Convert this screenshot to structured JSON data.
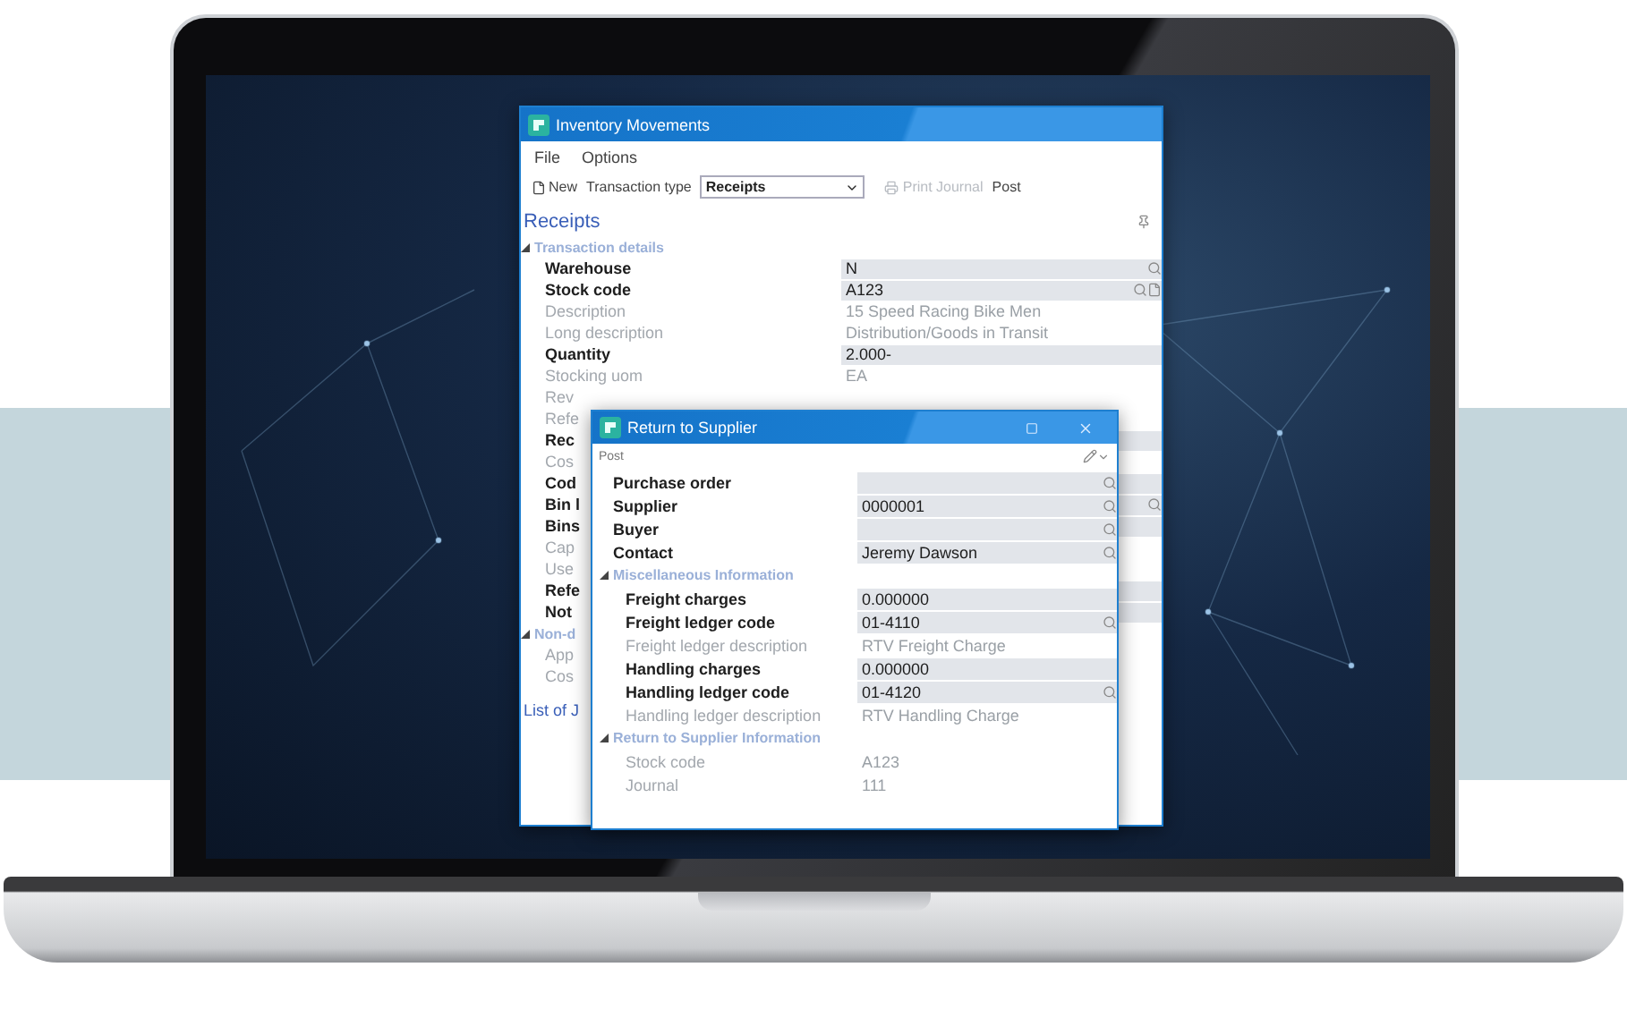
{
  "main_window": {
    "title": "Inventory Movements",
    "menu": [
      "File",
      "Options"
    ],
    "toolbar": {
      "new_button": "New",
      "type_label": "Transaction type",
      "type_value": "Receipts",
      "print_journal": {
        "label": "Print Journal",
        "disabled": true
      },
      "post": "Post"
    },
    "heading": "Receipts",
    "sections": [
      {
        "title": "Transaction details",
        "expanded": true,
        "rows": [
          {
            "label": "Warehouse",
            "value": "N",
            "kind": "lookup",
            "disabled": false
          },
          {
            "label": "Stock code",
            "value": "A123",
            "kind": "lookup_attach",
            "disabled": false
          },
          {
            "label": "Description",
            "value": "15 Speed Racing Bike Men",
            "kind": "field",
            "disabled": true
          },
          {
            "label": "Long description",
            "value": "Distribution/Goods in Transit",
            "kind": "field",
            "disabled": true
          },
          {
            "label": "Quantity",
            "value": "2.000-",
            "kind": "field",
            "disabled": false
          },
          {
            "label": "Stocking uom",
            "value": "EA",
            "kind": "field",
            "disabled": true
          },
          {
            "label": "Rev",
            "kind": "field",
            "disabled": true
          },
          {
            "label": "Refe",
            "kind": "field",
            "disabled": true
          },
          {
            "label": "Rec",
            "kind": "field",
            "disabled": false
          },
          {
            "label": "Cos",
            "kind": "field",
            "disabled": true
          },
          {
            "label": "Cod",
            "kind": "field",
            "disabled": false
          },
          {
            "label": "Bin l",
            "kind": "lookup",
            "disabled": false
          },
          {
            "label": "Bins",
            "kind": "field",
            "disabled": false
          },
          {
            "label": "Cap",
            "kind": "field",
            "disabled": true
          },
          {
            "label": "Use",
            "kind": "field",
            "disabled": true
          },
          {
            "label": "Refe",
            "kind": "field",
            "disabled": false
          },
          {
            "label": "Not",
            "kind": "field",
            "disabled": false
          }
        ]
      },
      {
        "title": "Non-d",
        "expanded": true,
        "rows": [
          {
            "label": "App",
            "kind": "field",
            "disabled": true
          },
          {
            "label": "Cos",
            "kind": "field",
            "disabled": true
          }
        ]
      }
    ],
    "list_heading": "List of J"
  },
  "dialog": {
    "title": "Return to Supplier",
    "toolbar": {
      "post": "Post"
    },
    "rows": [
      {
        "label": "Purchase order",
        "kind": "lookup",
        "disabled": false
      },
      {
        "label": "Supplier",
        "value": "0000001",
        "kind": "lookup",
        "disabled": false
      },
      {
        "label": "Buyer",
        "kind": "lookup",
        "disabled": false
      },
      {
        "label": "Contact",
        "value": "Jeremy Dawson",
        "kind": "lookup",
        "disabled": false
      }
    ],
    "sections": [
      {
        "title": "Miscellaneous Information",
        "expanded": true,
        "rows": [
          {
            "label": "Freight charges",
            "value": "0.000000",
            "kind": "field",
            "disabled": false
          },
          {
            "label": "Freight ledger code",
            "value": "01-4110",
            "kind": "lookup",
            "disabled": false
          },
          {
            "label": "Freight ledger description",
            "value": "RTV Freight Charge",
            "kind": "field",
            "disabled": true
          },
          {
            "label": "Handling charges",
            "value": "0.000000",
            "kind": "field",
            "disabled": false
          },
          {
            "label": "Handling ledger code",
            "value": "01-4120",
            "kind": "lookup",
            "disabled": false
          },
          {
            "label": "Handling ledger description",
            "value": "RTV Handling Charge",
            "kind": "field",
            "disabled": true
          }
        ]
      },
      {
        "title": "Return to Supplier Information",
        "expanded": true,
        "rows": [
          {
            "label": "Stock code",
            "value": "A123",
            "kind": "field",
            "disabled": true
          },
          {
            "label": "Journal",
            "value": "111",
            "kind": "field",
            "disabled": true
          }
        ]
      }
    ]
  }
}
